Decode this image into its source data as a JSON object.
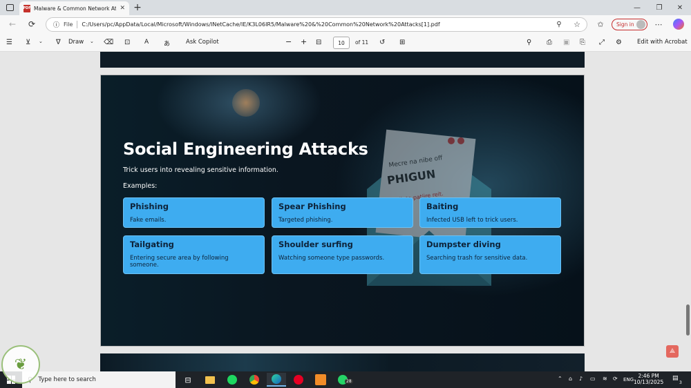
{
  "browser": {
    "tab_title": "Malware & Common Network Att",
    "tab_close": "✕",
    "new_tab": "+",
    "address_file": "File",
    "address_url": "C:/Users/pc/AppData/Local/Microsoft/Windows/INetCache/IE/K3L06IR5/Malware%20&%20Common%20Network%20Attacks[1].pdf",
    "sign_in": "Sign in",
    "win_min": "—",
    "win_max": "❐",
    "win_close": "✕"
  },
  "pdf_toolbar": {
    "draw": "Draw",
    "ask_copilot": "Ask Copilot",
    "zoom_out": "−",
    "zoom_in": "+",
    "page_current": "10",
    "page_total": "of 11",
    "edit_acrobat": "Edit with Acrobat"
  },
  "slide": {
    "title": "Social Engineering Attacks",
    "subtitle": "Trick users into revealing sensitive information.",
    "examples_label": "Examples:",
    "cards": [
      {
        "heading": "Phishing",
        "desc": "Fake emails."
      },
      {
        "heading": "Spear Phishing",
        "desc": "Targeted phishing."
      },
      {
        "heading": "Baiting",
        "desc": "Infected USB left to trick users."
      },
      {
        "heading": "Tailgating",
        "desc": "Entering secure area by following someone."
      },
      {
        "heading": "Shoulder surfing",
        "desc": "Watching someone type passwords."
      },
      {
        "heading": "Dumpster diving",
        "desc": "Searching trash for sensitive data."
      }
    ],
    "bg_note_lines": [
      "Mecre na nibe off",
      "PHIGUN",
      "Abail, to patiire reit."
    ]
  },
  "taskbar": {
    "search_placeholder": "Type here to search",
    "lang": "ENG",
    "time": "2:46 PM",
    "date": "10/13/2025",
    "whatsapp_badge": "28",
    "notif_count": "3"
  },
  "colors": {
    "card_bg": "#3eacf0",
    "card_text": "#0d2238",
    "slide_bg": "#0a141c",
    "sign_in": "#c52d2d"
  }
}
